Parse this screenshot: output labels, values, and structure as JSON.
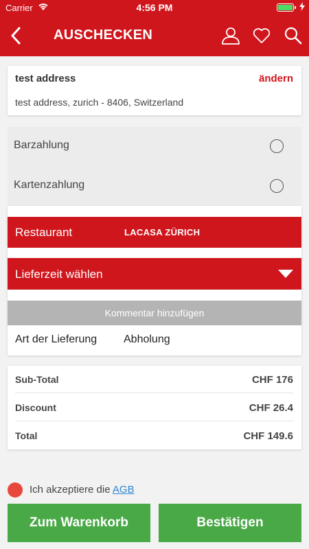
{
  "status_bar": {
    "carrier": "Carrier",
    "time": "4:56 PM",
    "battery_level": 1.0
  },
  "nav": {
    "title": "AUSCHECKEN",
    "icons": [
      "back-icon",
      "user-icon",
      "heart-icon",
      "search-icon"
    ]
  },
  "address": {
    "name": "test address",
    "change_label": "ändern",
    "full": "test address, zurich - 8406, Switzerland"
  },
  "payment": {
    "options": [
      {
        "label": "Barzahlung",
        "selected": false
      },
      {
        "label": "Kartenzahlung",
        "selected": false
      }
    ]
  },
  "restaurant": {
    "label": "Restaurant",
    "value": "LACASA ZÜRICH"
  },
  "delivery_time": {
    "label": "Lieferzeit wählen"
  },
  "comment": {
    "label": "Kommentar hinzufügen"
  },
  "delivery_type": {
    "label": "Art der Lieferung",
    "value": "Abholung"
  },
  "totals": [
    {
      "label": "Sub-Total",
      "value": "CHF 176"
    },
    {
      "label": "Discount",
      "value": "CHF 26.4"
    },
    {
      "label": "Total",
      "value": "CHF 149.6"
    }
  ],
  "terms": {
    "text": "Ich akzeptiere die ",
    "link": "AGB"
  },
  "buttons": {
    "cart": "Zum Warenkorb",
    "confirm": "Bestätigen"
  },
  "colors": {
    "brand": "#d0161d",
    "action": "#49a947",
    "link": "#2f86d1",
    "radio_accept": "#e8483b"
  }
}
